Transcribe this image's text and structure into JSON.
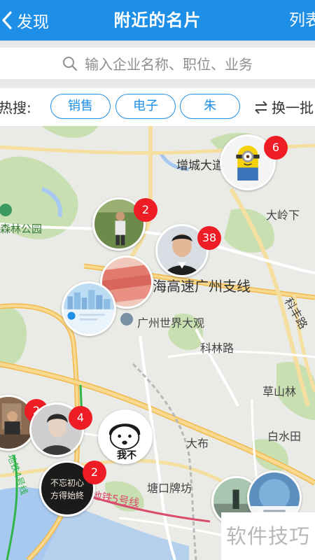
{
  "header": {
    "back_label": "发现",
    "title": "附近的名片",
    "right_action": "列表"
  },
  "search": {
    "placeholder": "输入企业名称、职位、业务"
  },
  "hot_search": {
    "label": "热搜:",
    "tags": [
      "销售",
      "电子",
      "朱"
    ],
    "refresh_label": "换一批"
  },
  "map": {
    "places": {
      "zengcheng": "增城大道",
      "forest_park": "森林公园",
      "daling": "大岭下",
      "expressway": "海高速广州支线",
      "world_expo": "广州世界大观",
      "kelin_road": "科林路",
      "kefeng_road": "科丰路",
      "caoshanlin": "草山林",
      "baishuitian": "白水田",
      "dabu": "大布",
      "tangkou": "塘口牌坊",
      "metro": "地铁5号线",
      "metro4": "地铁4号线",
      "road_kan": "路",
      "road_ke": "科"
    },
    "pins": [
      {
        "name": "minion",
        "count": "6"
      },
      {
        "name": "man-field",
        "count": "2"
      },
      {
        "name": "young-man",
        "count": "38"
      },
      {
        "name": "money",
        "count": ""
      },
      {
        "name": "city-card",
        "count": ""
      },
      {
        "name": "office-man",
        "count": "2"
      },
      {
        "name": "portrait",
        "count": "4"
      },
      {
        "name": "meme",
        "count": ""
      },
      {
        "name": "calligraphy",
        "count": "2"
      },
      {
        "name": "street",
        "count": ""
      },
      {
        "name": "blue-card",
        "count": ""
      }
    ],
    "meme_text": "我不",
    "calligraphy_text": "不忘初心 方得始終"
  },
  "watermark": "软件技巧",
  "colors": {
    "accent": "#1e8fe6",
    "badge": "#ee1c24"
  }
}
